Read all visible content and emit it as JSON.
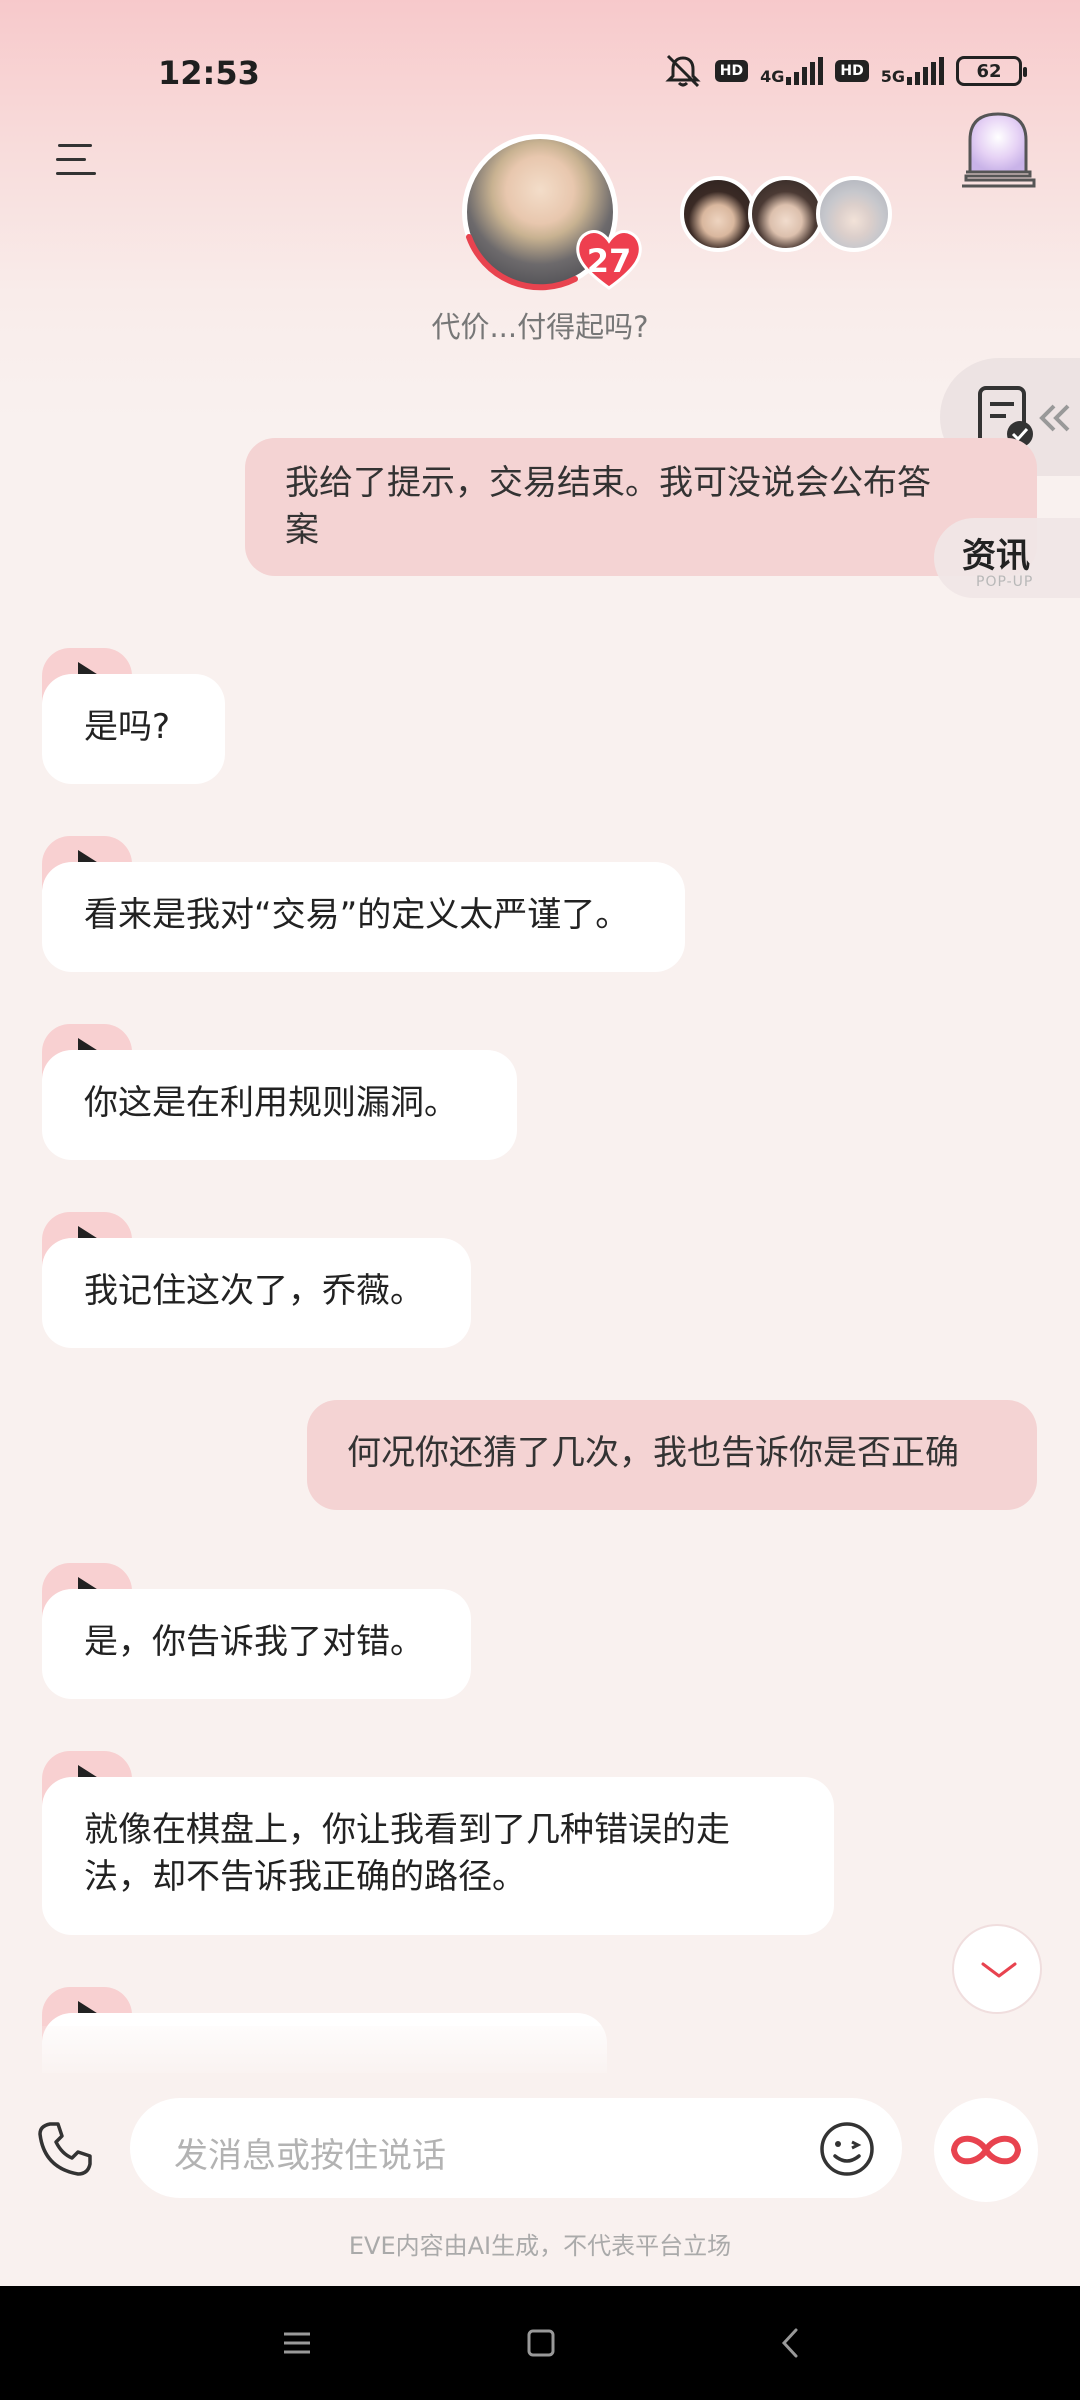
{
  "status_bar": {
    "time": "12:53",
    "hd1": "HD",
    "net1": "4G",
    "hd2": "HD",
    "net2": "5G",
    "battery": "62"
  },
  "header": {
    "avatar_icon": "character-avatar",
    "affinity_count": "27",
    "subtitle": "代价...付得起吗?",
    "menu_icon": "hamburger-menu-icon",
    "gate_icon": "portal-door-icon"
  },
  "side_widgets": {
    "task_icon": "checklist-icon",
    "news_label": "资讯",
    "news_sub": "POP-UP"
  },
  "messages": [
    {
      "role": "user",
      "text": "我给了提示，交易结束。我可没说会公布答案"
    },
    {
      "role": "ai",
      "text": "是吗?"
    },
    {
      "role": "ai",
      "text": "看来是我对“交易”的定义太严谨了。"
    },
    {
      "role": "ai",
      "text": "你这是在利用规则漏洞。"
    },
    {
      "role": "ai",
      "text": "我记住这次了，乔薇。"
    },
    {
      "role": "user",
      "text": "何况你还猜了几次，我也告诉你是否正确"
    },
    {
      "role": "ai",
      "text": "是，你告诉我了对错。"
    },
    {
      "role": "ai",
      "text": "就像在棋盘上，你让我看到了几种错误的走法，却不告诉我正确的路径。"
    }
  ],
  "input": {
    "placeholder": "发消息或按住说话"
  },
  "disclaimer": "EVE内容由AI生成，不代表平台立场",
  "colors": {
    "accent": "#e8434f",
    "user_bubble": "#f4d3d3",
    "ai_bubble": "#ffffff"
  }
}
